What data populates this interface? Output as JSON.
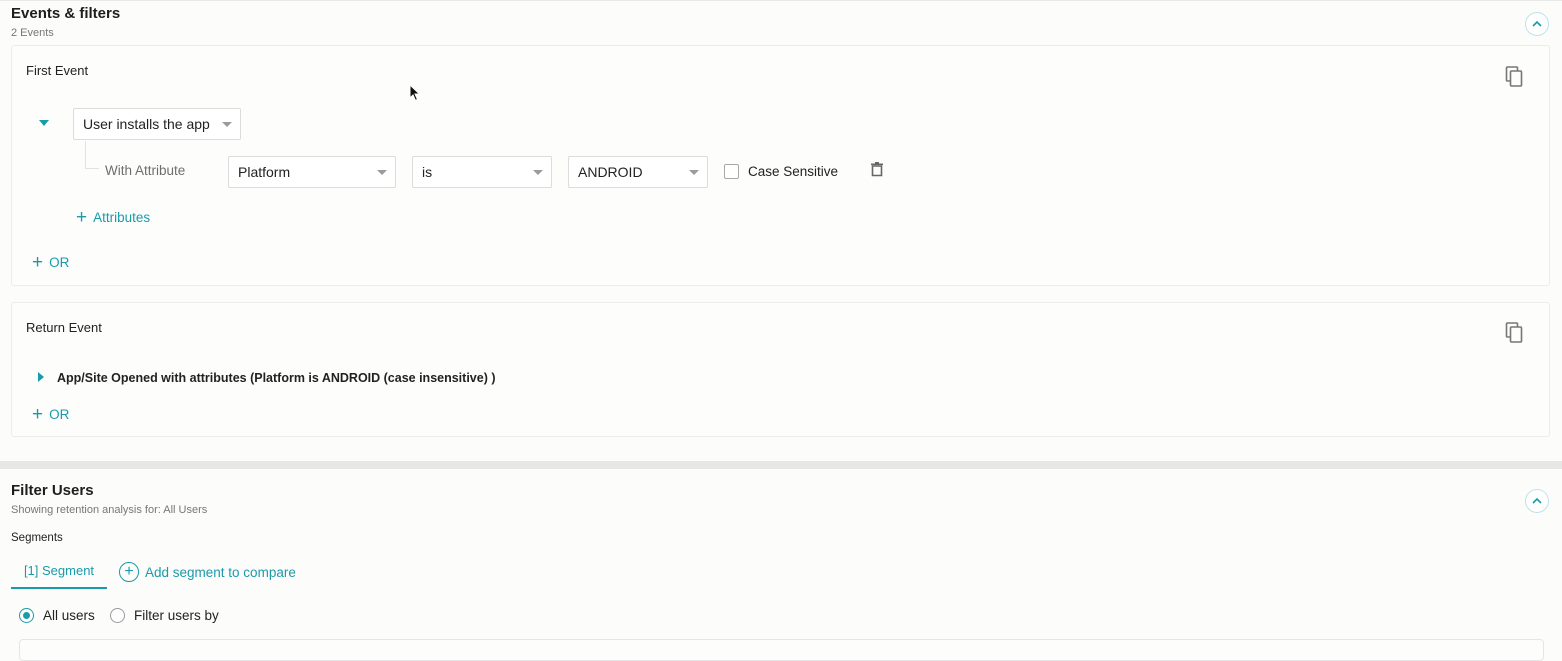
{
  "events_filters": {
    "title": "Events & filters",
    "subtitle": "2 Events",
    "first_event": {
      "title": "First Event",
      "event_select": "User installs the app",
      "with_attribute_label": "With Attribute",
      "attribute_select": "Platform",
      "operator_select": "is",
      "value_select": "ANDROID",
      "case_sensitive_label": "Case Sensitive",
      "add_attributes": "Attributes",
      "or_label": "OR"
    },
    "return_event": {
      "title": "Return Event",
      "summary": "App/Site Opened with attributes (Platform is ANDROID (case insensitive) )",
      "or_label": "OR"
    }
  },
  "filter_users": {
    "title": "Filter Users",
    "subtitle": "Showing retention analysis for: All Users",
    "segments_label": "Segments",
    "segment_tab": "[1] Segment",
    "add_segment": "Add segment to compare",
    "radio_all": "All users",
    "radio_filter": "Filter users by"
  },
  "colors": {
    "accent": "#1a9bab",
    "background": "#fcfcfb"
  },
  "icons": [
    "chevron-up-icon",
    "copy-icon",
    "caret-down-icon",
    "caret-right-icon",
    "trash-icon",
    "plus-icon",
    "mouse-cursor-icon"
  ]
}
